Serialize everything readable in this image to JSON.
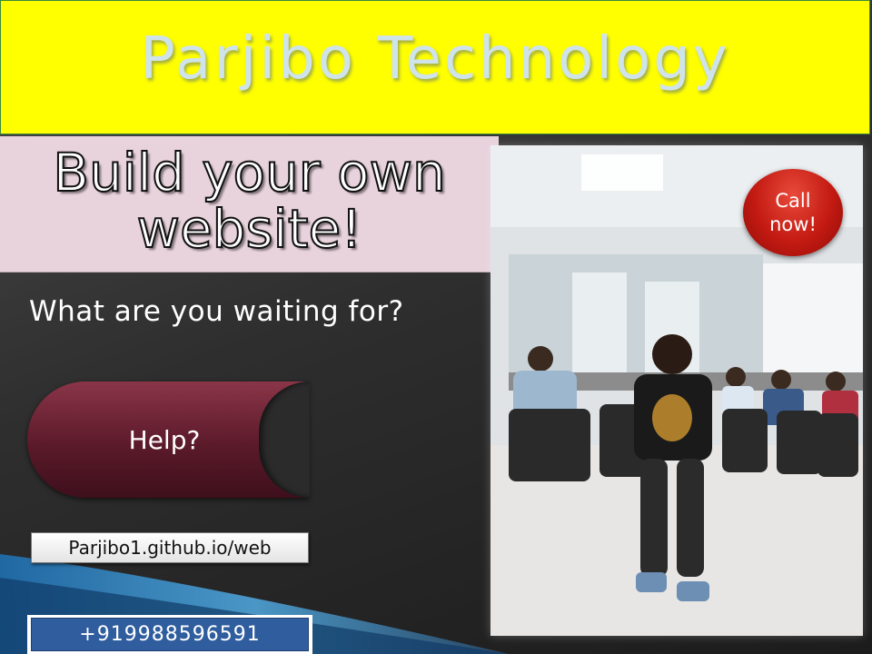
{
  "banner": {
    "title": "Parjibo Technology"
  },
  "headline": {
    "line1": "Build your own",
    "line2": "website!"
  },
  "subtitle": "What are you waiting for?",
  "help_button": {
    "label": "Help?"
  },
  "url": "Parjibo1.github.io/web",
  "phone": "+919988596591",
  "call_button": {
    "line1": "Call",
    "line2": "now!"
  },
  "colors": {
    "banner_bg": "#ffff00",
    "headline_bg": "#e8d2dc",
    "help_button": "#5b1a2a",
    "call_button": "#c31a12",
    "phone_bg": "#2f5d9e"
  }
}
